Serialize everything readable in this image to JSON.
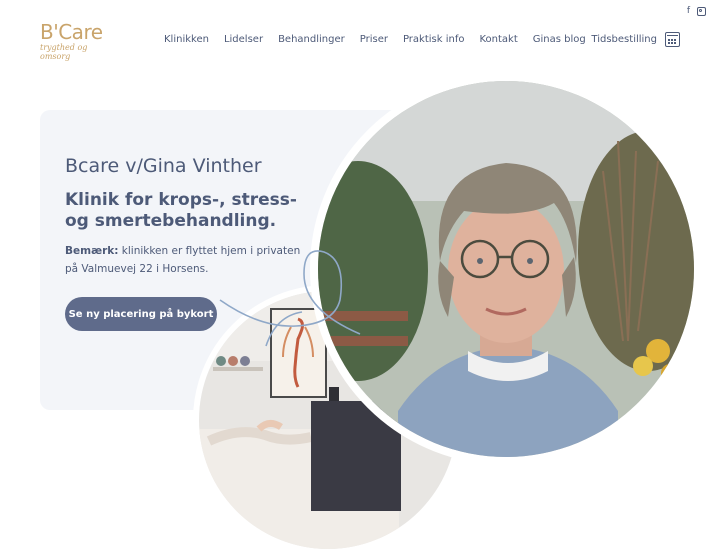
{
  "header": {
    "logo": {
      "name": "B'Care",
      "tagline": "trygthed og omsorg"
    },
    "nav": [
      {
        "label": "Klinikken"
      },
      {
        "label": "Lidelser"
      },
      {
        "label": "Behandlinger"
      },
      {
        "label": "Priser"
      },
      {
        "label": "Praktisk info"
      },
      {
        "label": "Kontakt"
      },
      {
        "label": "Ginas blog"
      }
    ],
    "booking_label": "Tidsbestilling",
    "social": [
      {
        "icon": "facebook-icon",
        "glyph": "f"
      },
      {
        "icon": "instagram-icon"
      }
    ]
  },
  "hero": {
    "title": "Bcare v/Gina Vinther",
    "subtitle": "Klinik for krops-, stress- og smertebehandling.",
    "note_label": "Bemærk:",
    "note_text": " klinikken er flyttet hjem i privaten på Valmuevej 22 i Horsens.",
    "cta_label": "Se ny placering på bykort"
  },
  "colors": {
    "accent": "#4d5a78",
    "brand_gold": "#c9a46b",
    "button": "#5f6b8b",
    "card_bg": "#f3f5f9"
  }
}
